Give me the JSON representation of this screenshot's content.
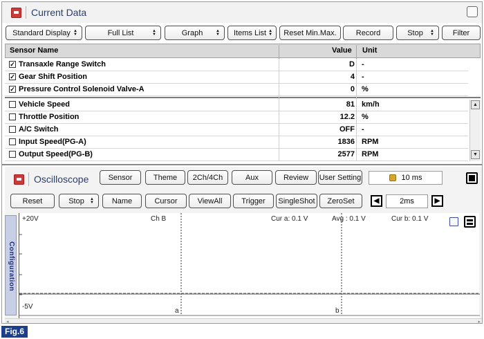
{
  "current_data": {
    "title": "Current Data",
    "toolbar": [
      {
        "label": "Standard Display",
        "dropdown": true
      },
      {
        "label": "Full List",
        "dropdown": true
      },
      {
        "label": "Graph",
        "dropdown": true
      },
      {
        "label": "Items List",
        "dropdown": true
      },
      {
        "label": "Reset Min.Max.",
        "dropdown": false
      },
      {
        "label": "Record",
        "dropdown": false
      },
      {
        "label": "Stop",
        "dropdown": true
      },
      {
        "label": "Filter",
        "dropdown": false
      }
    ],
    "columns": {
      "name": "Sensor Name",
      "value": "Value",
      "unit": "Unit"
    },
    "pinned_rows": [
      {
        "checked": true,
        "name": "Transaxle Range Switch",
        "value": "D",
        "unit": "-"
      },
      {
        "checked": true,
        "name": "Gear Shift Position",
        "value": "4",
        "unit": "-"
      },
      {
        "checked": true,
        "name": "Pressure Control Solenoid Valve-A",
        "value": "0",
        "unit": "%"
      }
    ],
    "rows": [
      {
        "checked": false,
        "name": "Vehicle Speed",
        "value": "81",
        "unit": "km/h"
      },
      {
        "checked": false,
        "name": "Throttle Position",
        "value": "12.2",
        "unit": "%"
      },
      {
        "checked": false,
        "name": "A/C Switch",
        "value": "OFF",
        "unit": "-"
      },
      {
        "checked": false,
        "name": "Input Speed(PG-A)",
        "value": "1836",
        "unit": "RPM"
      },
      {
        "checked": false,
        "name": "Output Speed(PG-B)",
        "value": "2577",
        "unit": "RPM"
      }
    ]
  },
  "oscilloscope": {
    "title": "Oscilloscope",
    "top_buttons": [
      "Sensor",
      "Theme",
      "2Ch/4Ch",
      "Aux",
      "Review",
      "User Setting"
    ],
    "time_display": "10 ms",
    "bottom_buttons": [
      {
        "label": "Reset",
        "dropdown": false
      },
      {
        "label": "Stop",
        "dropdown": true
      },
      {
        "label": "Name",
        "dropdown": false
      },
      {
        "label": "Cursor",
        "dropdown": false
      },
      {
        "label": "ViewAll",
        "dropdown": false
      },
      {
        "label": "Trigger",
        "dropdown": false
      },
      {
        "label": "SingleShot",
        "dropdown": false
      },
      {
        "label": "ZeroSet",
        "dropdown": false
      }
    ],
    "timebase": "2ms",
    "config_tab": "Configuration",
    "plot": {
      "top_label": "+20V",
      "bottom_label": "-5V",
      "channel": "Ch B",
      "cur_a": "Cur a: 0.1 V",
      "avg": "Avg : 0.1 V",
      "cur_b": "Cur b: 0.1 V",
      "cursor_a": "a",
      "cursor_b": "b"
    }
  },
  "figure_label": "Fig.6"
}
